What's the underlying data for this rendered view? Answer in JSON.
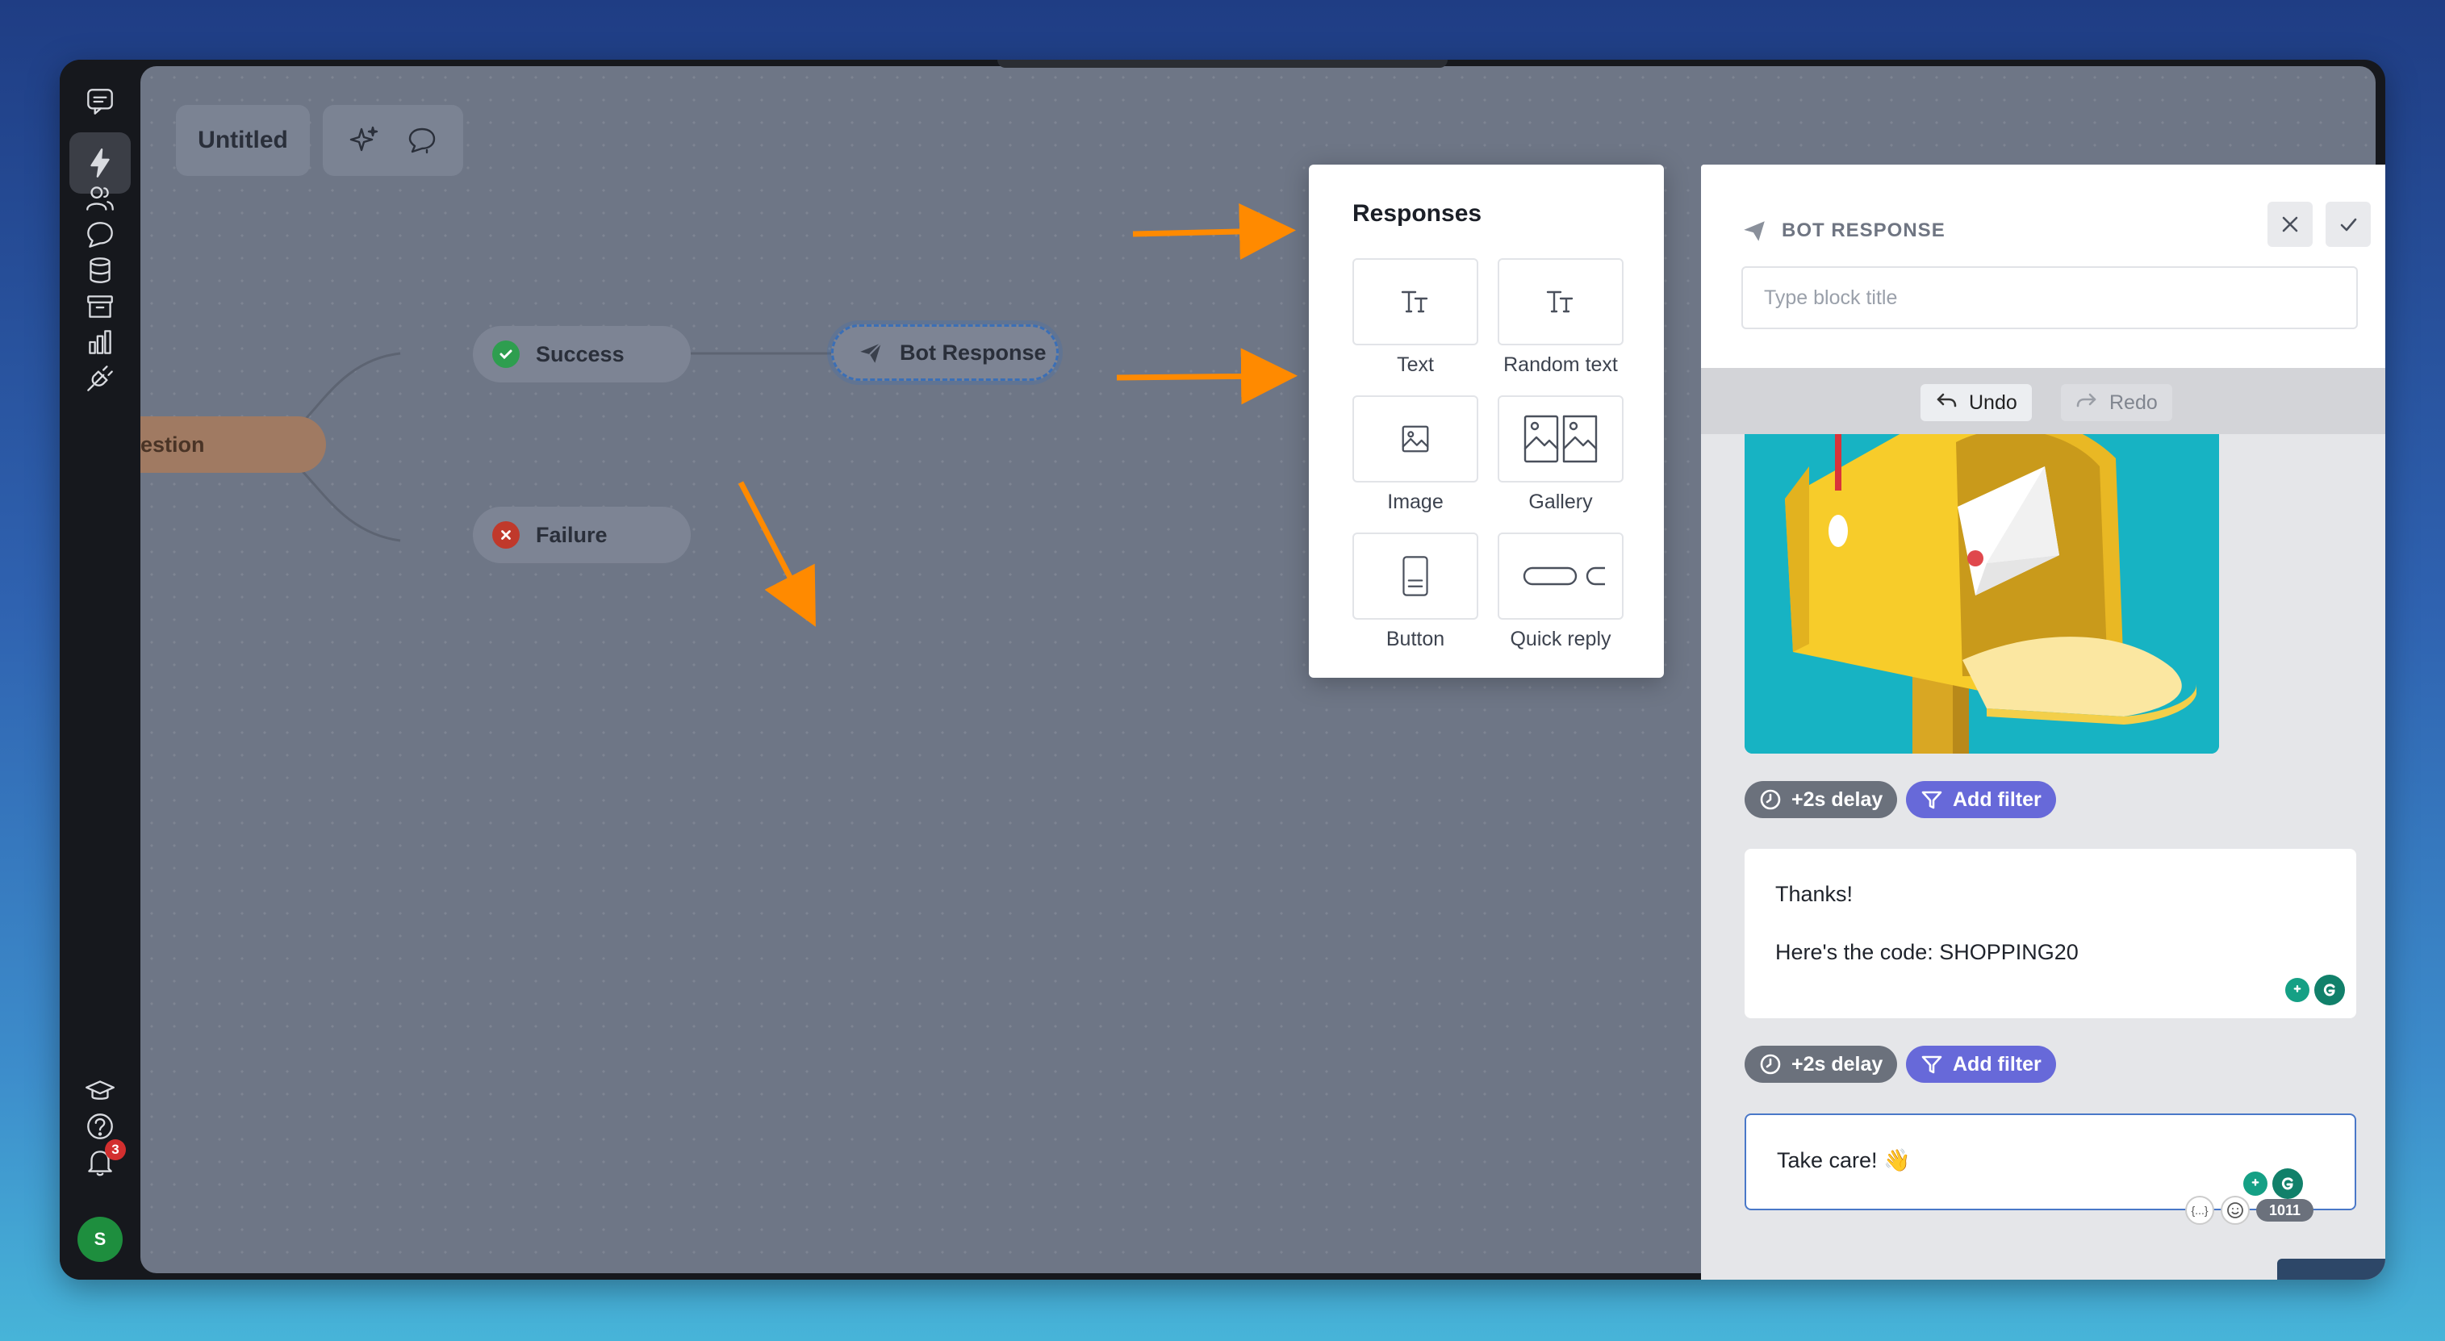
{
  "flow": {
    "title": "Untitled",
    "nodes": {
      "question": "estion",
      "success": "Success",
      "failure": "Failure",
      "bot_response": "Bot Response"
    }
  },
  "responses": {
    "heading": "Responses",
    "items": [
      "Text",
      "Random text",
      "Image",
      "Gallery",
      "Button",
      "Quick reply"
    ]
  },
  "panel": {
    "header": "BOT RESPONSE",
    "title_placeholder": "Type block title",
    "undo_label": "Undo",
    "redo_label": "Redo",
    "delay_label": "+2s delay",
    "filter_label": "Add filter",
    "messages": {
      "first_line1": "Thanks!",
      "first_line2": "Here's the code: SHOPPING20",
      "second": "Take care! 👋"
    },
    "var_tool": "{...}",
    "char_count": "1011"
  },
  "sidebar": {
    "notification_count": "3",
    "avatar_initial": "S"
  },
  "colors": {
    "canvas": "#6e7686",
    "accent_filter": "#6769d9",
    "arrow": "#ff8a00",
    "success": "#2e9e4f",
    "failure": "#c0392b"
  }
}
